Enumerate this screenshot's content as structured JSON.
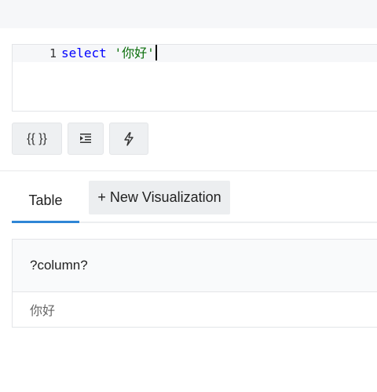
{
  "editor": {
    "line_number": "1",
    "code_keyword": "select",
    "code_string": "'你好'"
  },
  "toolbar": {
    "params_label": "{{ }}",
    "format_icon": "indent-icon",
    "autocomplete_icon": "lightning-icon"
  },
  "tabs": {
    "table_label": "Table",
    "new_viz_label": "+ New Visualization",
    "active_color": "#2f86d6"
  },
  "results": {
    "columns": [
      "?column?"
    ],
    "rows": [
      [
        "你好"
      ]
    ]
  }
}
